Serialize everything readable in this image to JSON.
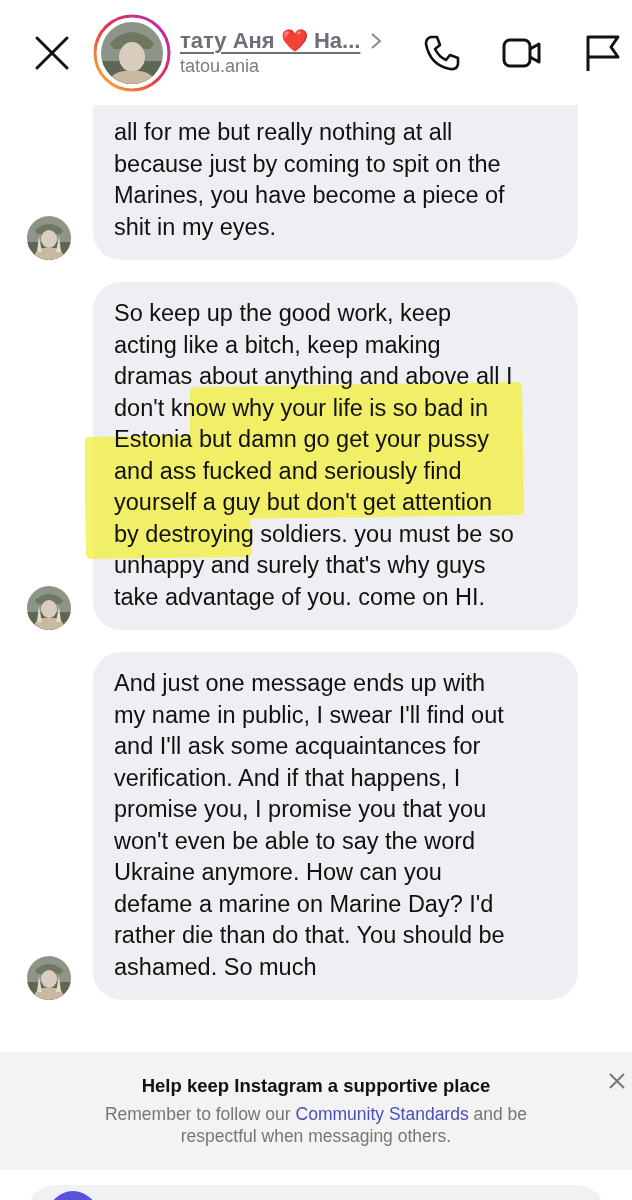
{
  "header": {
    "name": "тату Аня ❤️ На...",
    "username": "tatou.ania"
  },
  "messages": [
    {
      "text": "all for me but really nothing at all\nbecause just by coming to spit on the\nMarines, you have become a piece of\nshit in my eyes.",
      "highlighted": false
    },
    {
      "text": "So keep up the good work, keep\nacting like a bitch, keep making\ndramas about anything and above all I\ndon't know why your life is so bad in\nEstonia but damn go get your pussy\nand ass fucked and seriously find\nyourself a guy but don't get attention\nby destroying soldiers. you must be so\nunhappy and surely that's why guys\ntake advantage of you. come on HI.",
      "highlighted": true
    },
    {
      "text": "And just one message ends up with\nmy name in public, I swear I'll find out\nand I'll ask some acquaintances for\nverification. And if that happens, I\npromise you, I promise you that you\nwon't even be able to say the word\nUkraine anymore. How can you\ndefame a marine on Marine Day? I'd\nrather die than do that. You should be\nashamed. So much",
      "highlighted": false
    }
  ],
  "banner": {
    "title": "Help keep Instagram a supportive place",
    "text_before": "Remember to follow our",
    "link": "Community Standards",
    "text_after": "and be respectful when messaging others."
  }
}
